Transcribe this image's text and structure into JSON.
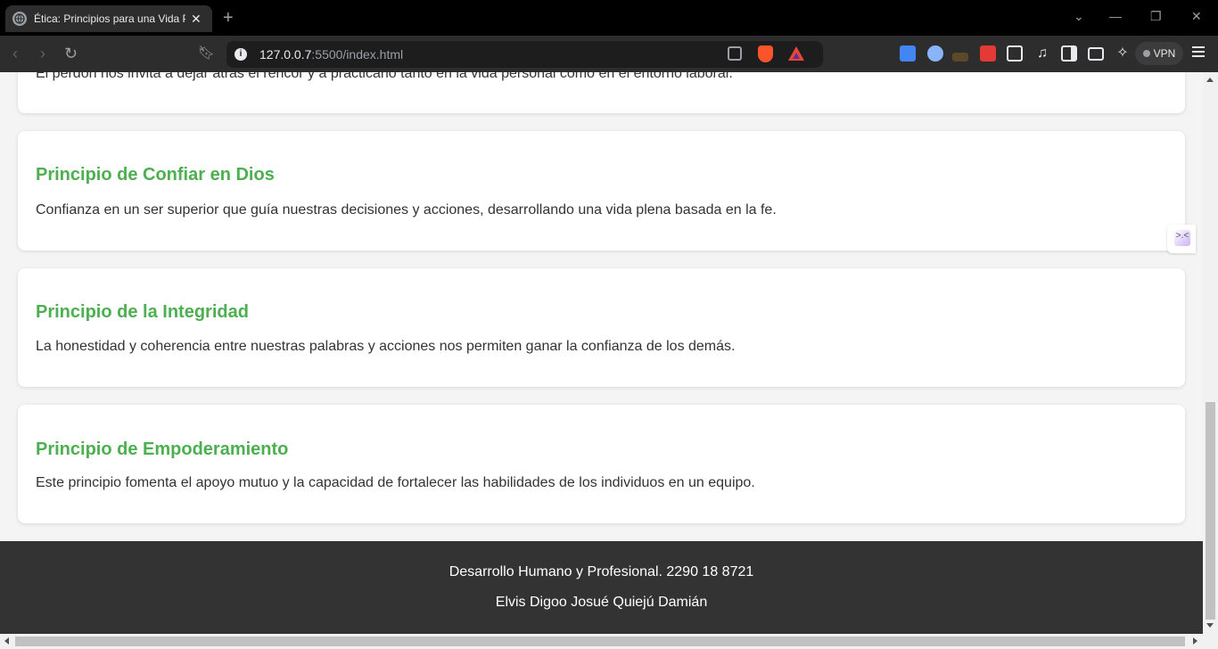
{
  "browser": {
    "tab_title": "Ética: Principios para una Vida Plena",
    "url_host": "127.0.0.7",
    "url_rest": ":5500/index.html",
    "vpn_label": "VPN",
    "icons": [
      "back-icon",
      "forward-icon",
      "reload-icon",
      "bookmark-icon",
      "info-icon",
      "share-icon",
      "brave-shields-icon",
      "brave-rewards-icon",
      "google-translate-icon",
      "extension-icon",
      "extension-icon",
      "extension-icon",
      "puzzle-icon",
      "music-icon",
      "sidebar-icon",
      "wallet-icon",
      "leo-ai-icon",
      "menu-icon"
    ]
  },
  "page": {
    "cut_off_text": "El perdón nos invita a dejar atrás el rencor y a practicarlo tanto en la vida personal como en el entorno laboral.",
    "principles": [
      {
        "title": "Principio de Confiar en Dios",
        "text": "Confianza en un ser superior que guía nuestras decisiones y acciones, desarrollando una vida plena basada en la fe."
      },
      {
        "title": "Principio de la Integridad",
        "text": "La honestidad y coherencia entre nuestras palabras y acciones nos permiten ganar la confianza de los demás."
      },
      {
        "title": "Principio de Empoderamiento",
        "text": "Este principio fomenta el apoyo mutuo y la capacidad de fortalecer las habilidades de los individuos en un equipo."
      }
    ],
    "footer": {
      "line1": "Desarrollo Humano y Profesional. 2290 18 8721",
      "line2": "Elvis Digoo Josué Quiejú Damián"
    }
  },
  "colors": {
    "heading": "#4caf50",
    "footer_bg": "#333333"
  }
}
